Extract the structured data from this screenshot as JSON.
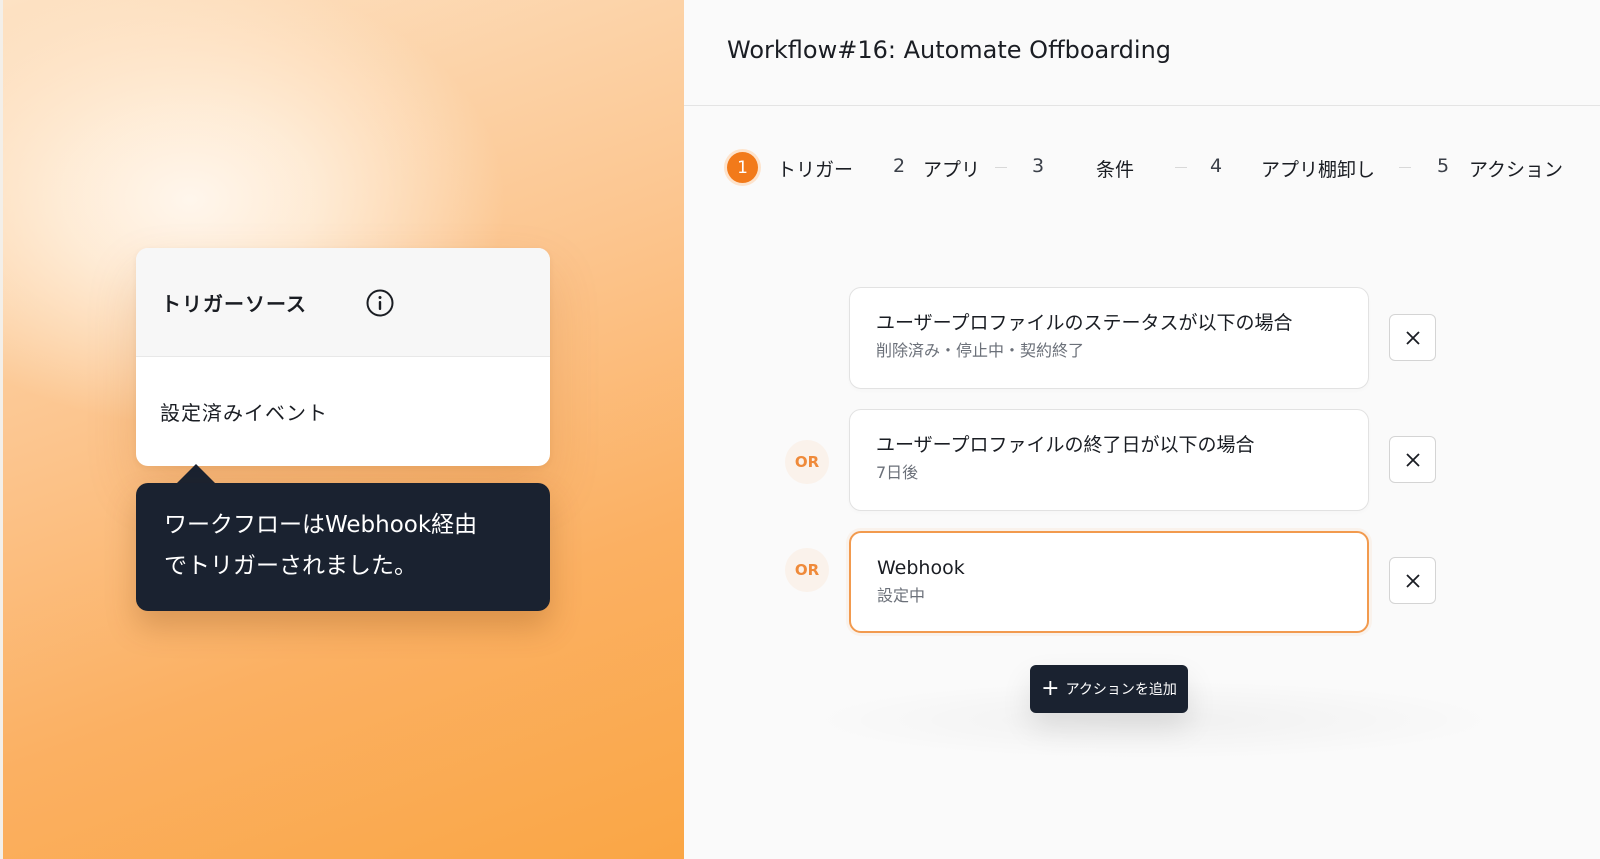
{
  "left": {
    "source_card": {
      "title": "トリガーソース",
      "info_icon": "info-icon",
      "event": "設定済みイベント"
    },
    "tooltip": {
      "line1": "ワークフローはWebhook経由",
      "line2": "でトリガーされました。"
    }
  },
  "header": {
    "title": "Workflow#16: Automate Offboarding"
  },
  "steps": [
    {
      "num": "1",
      "label": "トリガー",
      "active": true
    },
    {
      "num": "2",
      "label": "アプリ"
    },
    {
      "num": "3",
      "label": "条件"
    },
    {
      "num": "4",
      "label": "アプリ棚卸し"
    },
    {
      "num": "5",
      "label": "アクション"
    }
  ],
  "conditions": [
    {
      "title": "ユーザープロファイルのステータスが以下の場合",
      "subtitle": "削除済み・停止中・契約終了",
      "connector": ""
    },
    {
      "title": "ユーザープロファイルの終了日が以下の場合",
      "subtitle": "7日後",
      "connector": "OR"
    },
    {
      "title": "Webhook",
      "subtitle": "設定中",
      "connector": "OR"
    }
  ],
  "add_button": {
    "icon": "plus-icon",
    "label": "アクションを追加"
  },
  "colors": {
    "accent": "#f27a1a",
    "dark": "#1a2230",
    "or_text": "#ef8a3a"
  }
}
